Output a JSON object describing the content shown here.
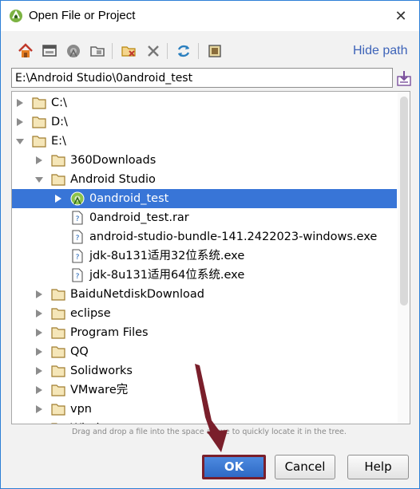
{
  "window": {
    "title": "Open File or Project",
    "close_glyph": "✕"
  },
  "toolbar": {
    "icons": [
      "home-icon",
      "desktop-icon",
      "android-project-icon",
      "new-folder-icon",
      "delete-folder-icon",
      "delete-icon",
      "refresh-icon",
      "show-hidden-icon"
    ],
    "hide_path_label": "Hide path"
  },
  "path": {
    "value": "E:\\Android Studio\\0android_test"
  },
  "tree": {
    "rows": [
      {
        "label": "C:\\",
        "indent": 0,
        "arrow": "right",
        "icon": "folder-icon"
      },
      {
        "label": "D:\\",
        "indent": 0,
        "arrow": "right",
        "icon": "folder-icon"
      },
      {
        "label": "E:\\",
        "indent": 0,
        "arrow": "down",
        "icon": "folder-icon"
      },
      {
        "label": "360Downloads",
        "indent": 1,
        "arrow": "right",
        "icon": "folder-icon"
      },
      {
        "label": "Android Studio",
        "indent": 1,
        "arrow": "down",
        "icon": "folder-icon"
      },
      {
        "label": "0android_test",
        "indent": 2,
        "arrow": "right",
        "icon": "android-project-icon",
        "selected": true
      },
      {
        "label": "0android_test.rar",
        "indent": 2,
        "arrow": "none",
        "icon": "unknown-file-icon"
      },
      {
        "label": "android-studio-bundle-141.2422023-windows.exe",
        "indent": 2,
        "arrow": "none",
        "icon": "unknown-file-icon"
      },
      {
        "label": "jdk-8u131适用32位系统.exe",
        "indent": 2,
        "arrow": "none",
        "icon": "unknown-file-icon"
      },
      {
        "label": "jdk-8u131适用64位系统.exe",
        "indent": 2,
        "arrow": "none",
        "icon": "unknown-file-icon"
      },
      {
        "label": "BaiduNetdiskDownload",
        "indent": 1,
        "arrow": "right",
        "icon": "folder-icon"
      },
      {
        "label": "eclipse",
        "indent": 1,
        "arrow": "right",
        "icon": "folder-icon"
      },
      {
        "label": "Program Files",
        "indent": 1,
        "arrow": "right",
        "icon": "folder-icon"
      },
      {
        "label": "QQ",
        "indent": 1,
        "arrow": "right",
        "icon": "folder-icon"
      },
      {
        "label": "Solidworks",
        "indent": 1,
        "arrow": "right",
        "icon": "folder-icon"
      },
      {
        "label": "VMware完",
        "indent": 1,
        "arrow": "right",
        "icon": "folder-icon"
      },
      {
        "label": "vpn",
        "indent": 1,
        "arrow": "right",
        "icon": "folder-icon"
      },
      {
        "label": "Windows",
        "indent": 1,
        "arrow": "right",
        "icon": "folder-icon"
      }
    ]
  },
  "hint": {
    "text": "Drag and drop a file into the space above to quickly locate it in the tree."
  },
  "buttons": {
    "ok": "OK",
    "cancel": "Cancel",
    "help": "Help"
  },
  "colors": {
    "selection": "#3875d7",
    "link": "#3d63b8",
    "annotation": "#7a1f2b"
  }
}
